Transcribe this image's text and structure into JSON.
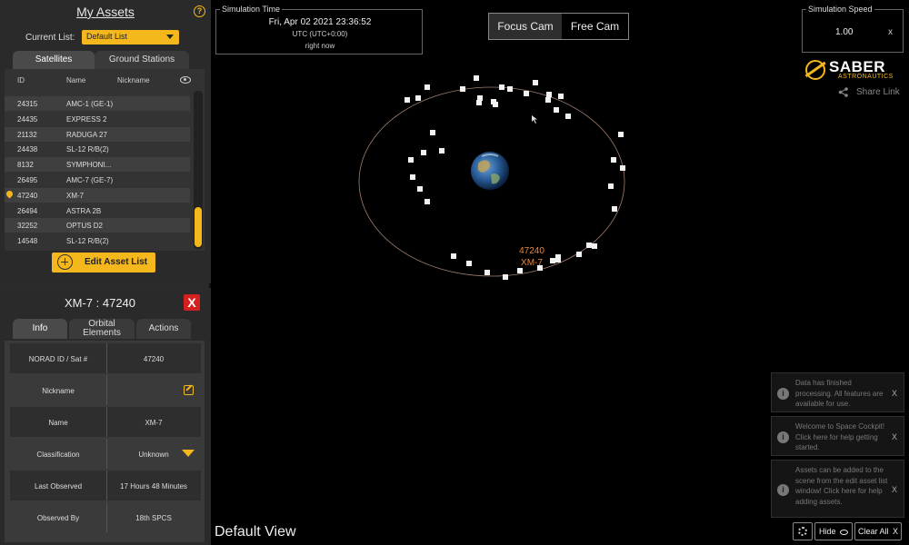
{
  "assets": {
    "title": "My Assets",
    "help_icon": "?",
    "current_list_label": "Current List:",
    "current_list_value": "Default List",
    "tabs": [
      "Satellites",
      "Ground Stations"
    ],
    "columns": {
      "id": "ID",
      "name": "Name",
      "nickname": "Nickname"
    },
    "rows": [
      {
        "id": "24315",
        "name": "AMC-1 (GE-1)"
      },
      {
        "id": "24435",
        "name": "EXPRESS 2"
      },
      {
        "id": "21132",
        "name": "RADUGA 27"
      },
      {
        "id": "24438",
        "name": "SL-12 R/B(2)"
      },
      {
        "id": "8132",
        "name": "SYMPHONI..."
      },
      {
        "id": "26495",
        "name": "AMC-7 (GE-7)"
      },
      {
        "id": "47240",
        "name": "XM-7"
      },
      {
        "id": "26494",
        "name": "ASTRA 2B"
      },
      {
        "id": "32252",
        "name": "OPTUS D2"
      },
      {
        "id": "14548",
        "name": "SL-12 R/B(2)"
      }
    ],
    "edit_button": "Edit Asset List"
  },
  "detail": {
    "title": "XM-7 : 47240",
    "close": "X",
    "tabs": [
      "Info",
      "Orbital Elements",
      "Actions"
    ],
    "rows": [
      {
        "key": "NORAD ID / Sat #",
        "value": "47240"
      },
      {
        "key": "Nickname",
        "value": ""
      },
      {
        "key": "Name",
        "value": "XM-7"
      },
      {
        "key": "Classification",
        "value": "Unknown"
      },
      {
        "key": "Last Observed",
        "value": "17 Hours 48 Minutes"
      },
      {
        "key": "Observed By",
        "value": "18th SPCS"
      }
    ]
  },
  "sim_time": {
    "label": "Simulation Time",
    "datetime": "Fri, Apr 02 2021 23:36:52",
    "timezone": "UTC (UTC+0:00)",
    "status": "right now"
  },
  "camera": {
    "focus": "Focus Cam",
    "free": "Free Cam"
  },
  "speed": {
    "label": "Simulation Speed",
    "value": "1.00",
    "reset": "x"
  },
  "logo": {
    "line1": "SABER",
    "line2": "ASTRONAUTICS"
  },
  "share_link": "Share Link",
  "view_name": "Default View",
  "selected_label": {
    "id": "47240",
    "name": "XM-7"
  },
  "notifications": [
    {
      "text": "Data has finished processing. All features are available for use.",
      "close": "X"
    },
    {
      "text": "Welcome to Space Cockpit! Click here for help getting started.",
      "close": "X"
    },
    {
      "text": "Assets can be added to the scene from the edit asset list window! Click here for help adding assets.",
      "close": "X"
    }
  ],
  "bottom_buttons": {
    "hide": "Hide",
    "clear": "Clear All",
    "clear_x": "X"
  },
  "colors": {
    "accent": "#f5b81c",
    "close_red": "#d62020",
    "orbit_label": "#e8873a"
  }
}
